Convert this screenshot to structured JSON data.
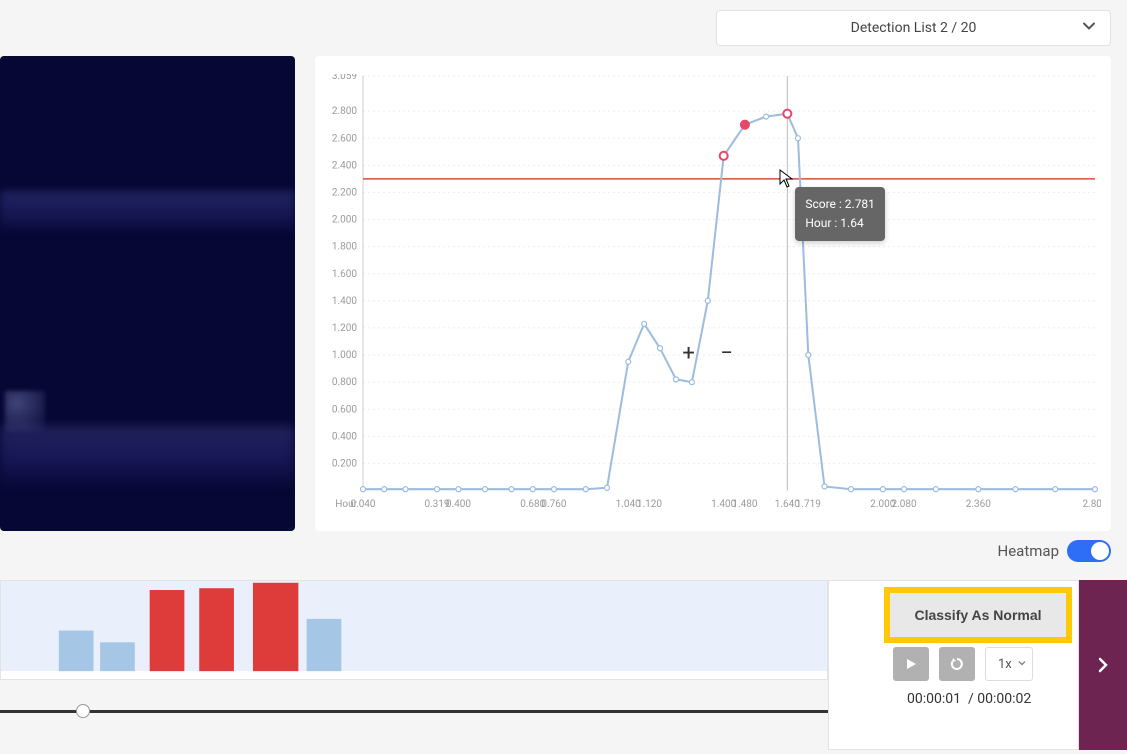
{
  "header": {
    "detection_label": "Detection List 2 / 20"
  },
  "chart_data": {
    "type": "line",
    "xlabel": "Hour",
    "ylabel": "",
    "ylim": [
      0,
      3.059
    ],
    "threshold": 2.3,
    "x_ticks": [
      "0.040",
      "0.319",
      "0.400",
      "0.680",
      "0.760",
      "1.040",
      "1.120",
      "1.400",
      "1.480",
      "1.640",
      "1.719",
      "2.000",
      "2.080",
      "2.360",
      "2.800"
    ],
    "y_ticks": [
      "0.200",
      "0.400",
      "0.600",
      "0.800",
      "1.000",
      "1.200",
      "1.400",
      "1.600",
      "1.800",
      "2.000",
      "2.200",
      "2.400",
      "2.600",
      "2.800",
      "3.059"
    ],
    "series": [
      {
        "name": "score",
        "points": [
          {
            "x": 0.04,
            "y": 0.01
          },
          {
            "x": 0.12,
            "y": 0.01
          },
          {
            "x": 0.2,
            "y": 0.01
          },
          {
            "x": 0.319,
            "y": 0.01
          },
          {
            "x": 0.4,
            "y": 0.01
          },
          {
            "x": 0.5,
            "y": 0.01
          },
          {
            "x": 0.6,
            "y": 0.01
          },
          {
            "x": 0.68,
            "y": 0.01
          },
          {
            "x": 0.76,
            "y": 0.01
          },
          {
            "x": 0.88,
            "y": 0.01
          },
          {
            "x": 0.96,
            "y": 0.02
          },
          {
            "x": 1.04,
            "y": 0.95
          },
          {
            "x": 1.1,
            "y": 1.23
          },
          {
            "x": 1.16,
            "y": 1.05
          },
          {
            "x": 1.22,
            "y": 0.82
          },
          {
            "x": 1.28,
            "y": 0.8
          },
          {
            "x": 1.34,
            "y": 1.4
          },
          {
            "x": 1.4,
            "y": 2.47
          },
          {
            "x": 1.48,
            "y": 2.7
          },
          {
            "x": 1.56,
            "y": 2.76
          },
          {
            "x": 1.64,
            "y": 2.781
          },
          {
            "x": 1.68,
            "y": 2.6
          },
          {
            "x": 1.719,
            "y": 1.0
          },
          {
            "x": 1.78,
            "y": 0.03
          },
          {
            "x": 1.88,
            "y": 0.01
          },
          {
            "x": 2.0,
            "y": 0.01
          },
          {
            "x": 2.08,
            "y": 0.01
          },
          {
            "x": 2.2,
            "y": 0.01
          },
          {
            "x": 2.36,
            "y": 0.01
          },
          {
            "x": 2.5,
            "y": 0.01
          },
          {
            "x": 2.65,
            "y": 0.01
          },
          {
            "x": 2.8,
            "y": 0.01
          }
        ]
      }
    ],
    "highlighted": [
      {
        "x": 1.4,
        "y": 2.47
      },
      {
        "x": 1.48,
        "y": 2.7
      },
      {
        "x": 1.64,
        "y": 2.781
      }
    ],
    "tooltip": {
      "score_label": "Score :",
      "score_value": "2.781",
      "hour_label": "Hour :",
      "hour_value": "1.64",
      "at_x": 1.64
    }
  },
  "timeline": {
    "bars": [
      {
        "pos": 0.07,
        "h": 0.45,
        "color": "#a6c6e6"
      },
      {
        "pos": 0.12,
        "h": 0.32,
        "color": "#a6c6e6"
      },
      {
        "pos": 0.18,
        "h": 0.9,
        "color": "#de3b3b"
      },
      {
        "pos": 0.24,
        "h": 0.92,
        "color": "#de3b3b"
      },
      {
        "pos": 0.305,
        "h": 0.98,
        "color": "#de3b3b",
        "w": 0.055
      },
      {
        "pos": 0.37,
        "h": 0.58,
        "color": "#a6c6e6"
      }
    ]
  },
  "controls": {
    "classify_label": "Classify As Normal",
    "speed_label": "1x",
    "current_time": "00:00:01",
    "time_sep": "/",
    "total_time": "00:00:02",
    "heatmap_label": "Heatmap"
  },
  "seek": {
    "progress": 0.1
  },
  "colors": {
    "threshold": "#db4b3a",
    "line": "#9cbce0",
    "highlight": "#e34a6a",
    "sidebar": "#6d2451",
    "accent_yellow": "#ffc905",
    "toggle_on": "#2e6ef7"
  }
}
